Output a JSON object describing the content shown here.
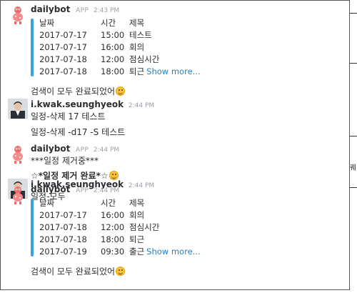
{
  "colors": {
    "attachment_bar": "#3aa3e3",
    "link": "#2a80b9",
    "meta": "#9e9ea6"
  },
  "messages": [
    {
      "sender": "dailybot",
      "app_badge": "APP",
      "time": "2:43 PM",
      "table": {
        "headers": [
          "날짜",
          "시간",
          "제목"
        ],
        "rows": [
          [
            "2017-07-17",
            "15:00",
            "테스트"
          ],
          [
            "2017-07-17",
            "16:00",
            "회의"
          ],
          [
            "2017-07-18",
            "12:00",
            "점심시간"
          ],
          [
            "2017-07-18",
            "18:00",
            "퇴근"
          ]
        ],
        "more": "Show more..."
      },
      "text": "검색이 모두 완료되었어",
      "emoji": "smile-emoji"
    },
    {
      "sender": "i.kwak.seunghyeok",
      "time": "2:44 PM",
      "lines": [
        "일정-삭제 17 테스트",
        "일정-삭제 -d17 -S 테스트"
      ]
    },
    {
      "sender": "dailybot",
      "app_badge": "APP",
      "time": "2:44 PM",
      "line1": "***일정 제거중***",
      "line2": "☆*일정 제거 완료*☆"
    },
    {
      "sender": "i.kwak.seunghyeok",
      "time": "2:44 PM",
      "lines": [
        "일정-모두"
      ]
    },
    {
      "sender": "dailybot",
      "app_badge": "APP",
      "time": "2:44 PM",
      "table": {
        "headers": [
          "날짜",
          "시간",
          "제목"
        ],
        "rows": [
          [
            "2017-07-17",
            "16:00",
            "회의"
          ],
          [
            "2017-07-18",
            "12:00",
            "점심시간"
          ],
          [
            "2017-07-18",
            "18:00",
            "퇴근"
          ],
          [
            "2017-07-19",
            "09:30",
            "출근"
          ]
        ],
        "more": "Show more..."
      },
      "text": "검색이 모두 완료되었어"
    }
  ],
  "edge_glyph": "퀘"
}
